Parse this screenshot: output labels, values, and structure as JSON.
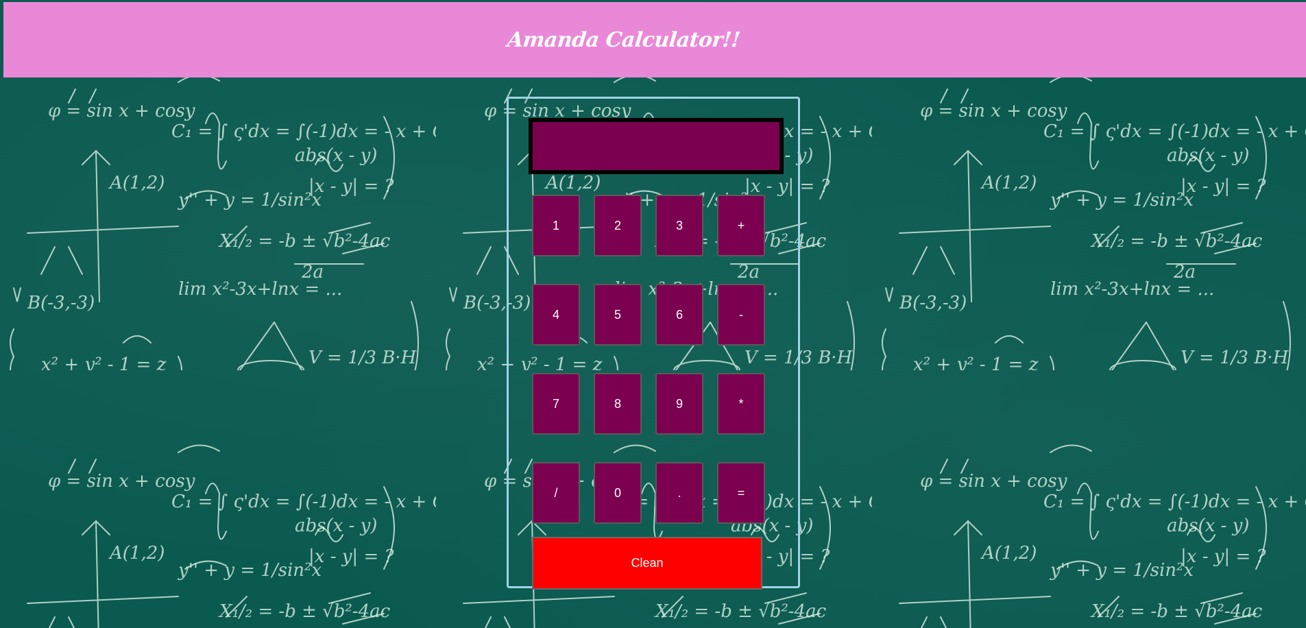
{
  "header": {
    "title": "Amanda Calculator!!"
  },
  "display": {
    "value": ""
  },
  "keys": [
    [
      "1",
      "2",
      "3",
      "+"
    ],
    [
      "4",
      "5",
      "6",
      "-"
    ],
    [
      "7",
      "8",
      "9",
      "*"
    ],
    [
      "/",
      "0",
      ".",
      "="
    ]
  ],
  "clean_label": "Clean",
  "colors": {
    "background": "#0b5a50",
    "header": "#ea88d8",
    "key": "#7b0050",
    "clean": "#ff0000",
    "frame": "#9ed3e6"
  }
}
